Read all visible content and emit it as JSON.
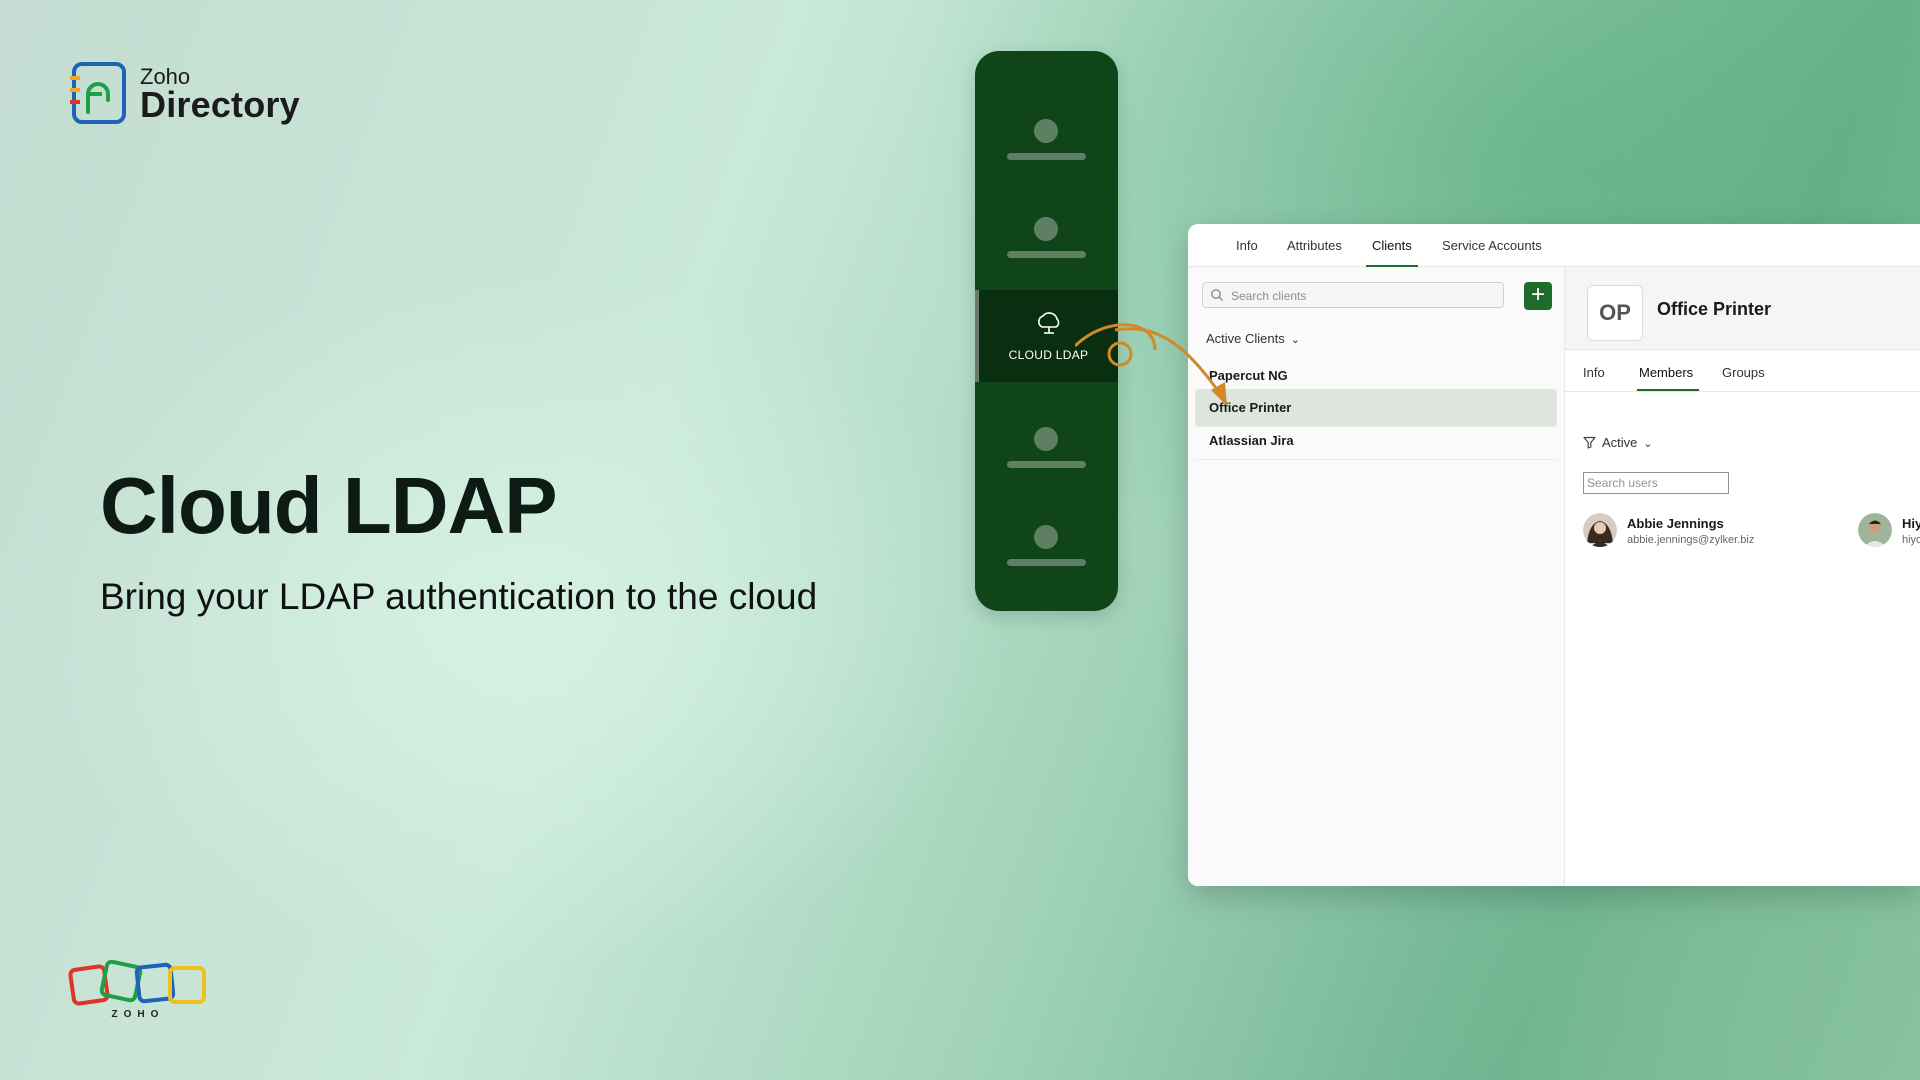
{
  "brand": {
    "small": "Zoho",
    "big": "Directory"
  },
  "hero": {
    "title": "Cloud LDAP",
    "subtitle": "Bring your LDAP authentication to the cloud"
  },
  "footer_logo": {
    "text": "ZOHO"
  },
  "rail": {
    "active_label": "CLOUD LDAP",
    "active_icon": "cloud-icon"
  },
  "window": {
    "tabs": [
      "Info",
      "Attributes",
      "Clients",
      "Service Accounts"
    ],
    "active_tab": "Clients",
    "search_placeholder": "Search clients",
    "filter_label": "Active Clients",
    "clients": [
      "Papercut NG",
      "Office Printer",
      "Atlassian Jira"
    ],
    "selected_client": "Office Printer",
    "detail": {
      "initials": "OP",
      "title": "Office Printer",
      "subtabs": [
        "Info",
        "Members",
        "Groups"
      ],
      "active_subtab": "Members",
      "status_filter": "Active",
      "user_search_placeholder": "Search users",
      "members": [
        {
          "name": "Abbie Jennings",
          "email": "abbie.jennings@zylker.biz"
        },
        {
          "name": "Hiy",
          "email": "hiyo"
        }
      ]
    }
  },
  "colors": {
    "accent": "#1f6b2c",
    "rail": "#0f4518",
    "arrow": "#d08a2a"
  }
}
